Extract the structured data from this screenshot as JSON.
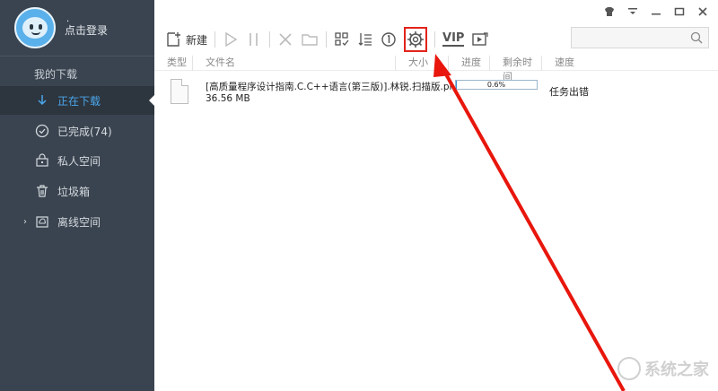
{
  "profile": {
    "login_label": "点击登录",
    "dot": "."
  },
  "sidebar": {
    "section_title": "我的下载",
    "items": [
      {
        "label": "正在下载",
        "icon": "download-arrow-icon",
        "active": true
      },
      {
        "label": "已完成(74)",
        "icon": "check-circle-icon"
      },
      {
        "label": "私人空间",
        "icon": "lock-box-icon"
      },
      {
        "label": "垃圾箱",
        "icon": "trash-icon"
      },
      {
        "label": "离线空间",
        "icon": "cloud-box-icon",
        "expandable": true
      }
    ]
  },
  "toolbar": {
    "new_label": "新建",
    "vip_label": "VIP"
  },
  "table": {
    "headers": [
      "类型",
      "文件名",
      "大小",
      "进度",
      "剩余时间",
      "速度"
    ],
    "rows": [
      {
        "name": "[高质量程序设计指南.C.C++语言(第三版)].林锐.扫描版.php",
        "size": "36.56 MB",
        "progress_text": "0.6%",
        "progress": 0.006,
        "speed": "任务出错"
      }
    ]
  },
  "watermark": {
    "text": "系统之家"
  },
  "colors": {
    "accent": "#4aa6ea",
    "sidebar_bg": "#3a4450",
    "highlight": "#e2231a"
  }
}
